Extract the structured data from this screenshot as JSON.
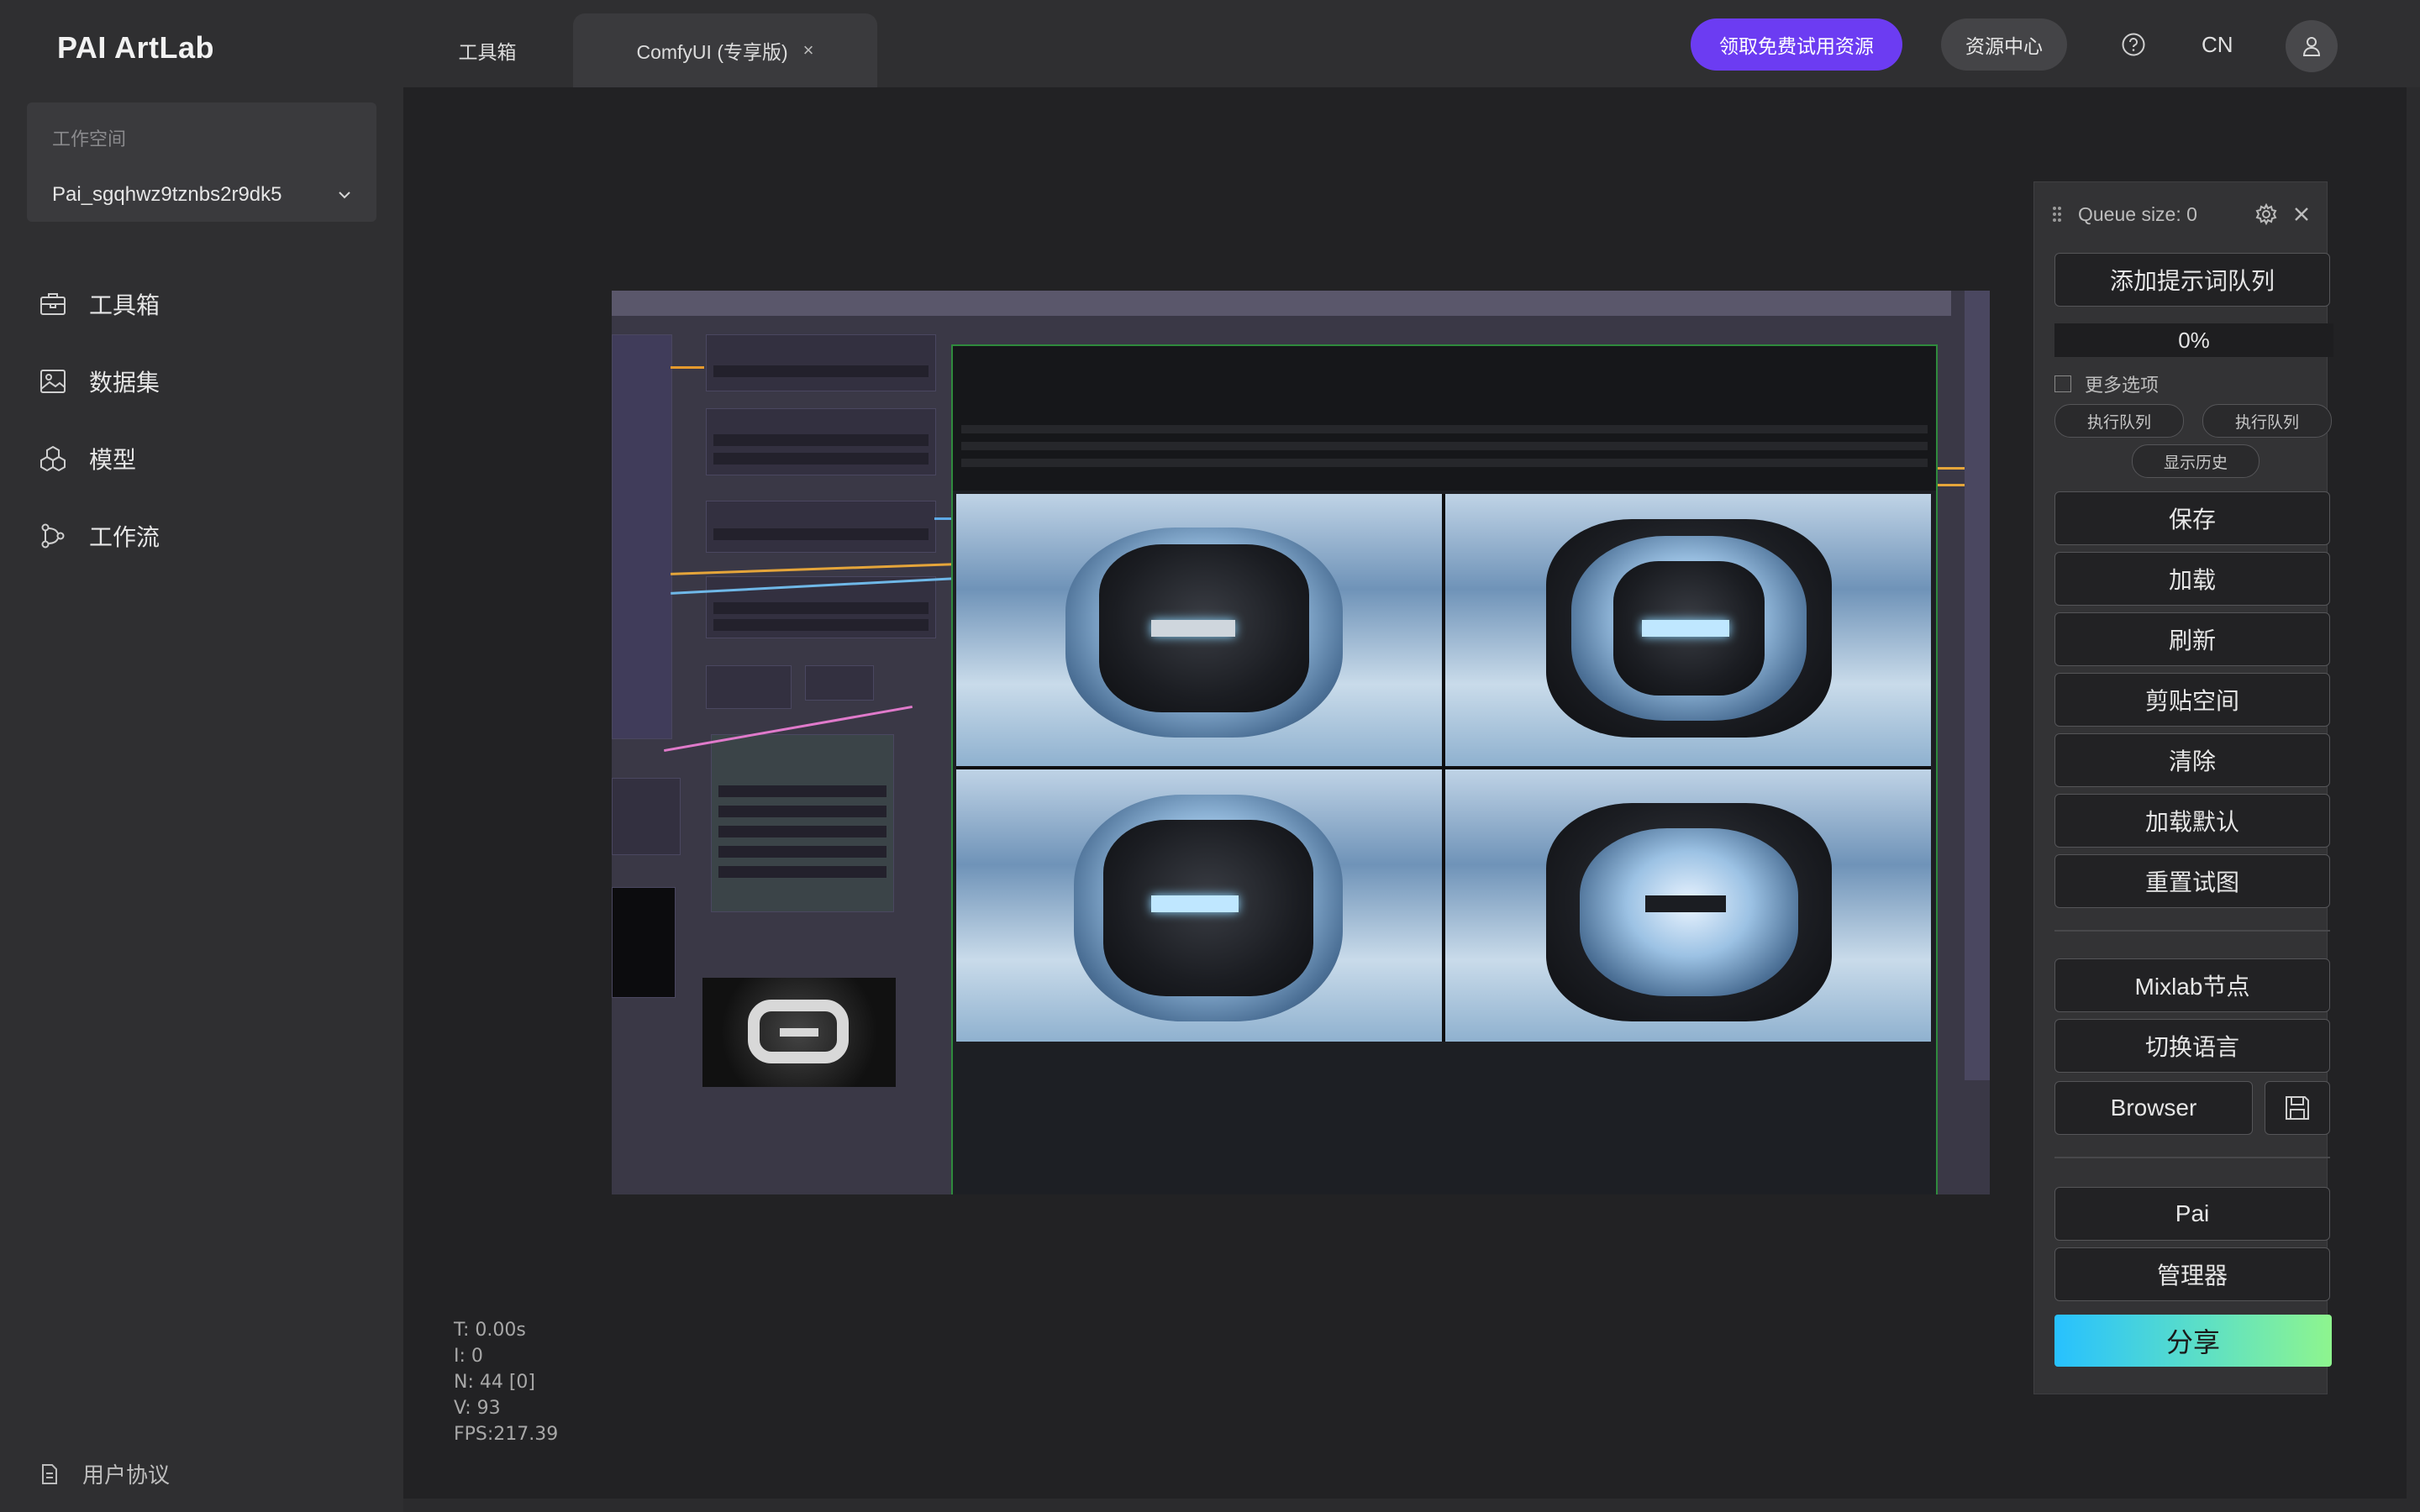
{
  "app": {
    "title": "PAI ArtLab"
  },
  "tabs": [
    {
      "label": "工具箱"
    },
    {
      "label": "ComfyUI (专享版)",
      "close": "×"
    }
  ],
  "header": {
    "trial_button": "领取免费试用资源",
    "resource_button": "资源中心",
    "language": "CN"
  },
  "sidebar": {
    "workspace_label": "工作空间",
    "workspace_value": "Pai_sgqhwz9tznbs2r9dk5",
    "items": [
      {
        "label": "工具箱",
        "icon": "toolbox-icon"
      },
      {
        "label": "数据集",
        "icon": "image-icon"
      },
      {
        "label": "模型",
        "icon": "cubes-icon"
      },
      {
        "label": "工作流",
        "icon": "workflow-icon"
      }
    ],
    "footer": "用户协议"
  },
  "stats": {
    "t": "T: 0.00s",
    "i": "I: 0",
    "n": "N: 44 [0]",
    "v": "V: 93",
    "fps": "FPS:217.39"
  },
  "queue_panel": {
    "title": "Queue size: 0",
    "add_prompt": "添加提示词队列",
    "progress": "0%",
    "more_options": "更多选项",
    "run_queue_1": "执行队列",
    "run_queue_2": "执行队列",
    "show_history": "显示历史",
    "buttons": [
      "保存",
      "加载",
      "刷新",
      "剪贴空间",
      "清除",
      "加载默认",
      "重置试图"
    ],
    "mixlab": "Mixlab节点",
    "switch_language": "切换语言",
    "browser": "Browser",
    "pai": "Pai",
    "manager": "管理器",
    "share": "分享"
  },
  "colors": {
    "accent": "#6c3cf2",
    "share_gradient_start": "#27c1ff",
    "share_gradient_end": "#8ef58e"
  }
}
